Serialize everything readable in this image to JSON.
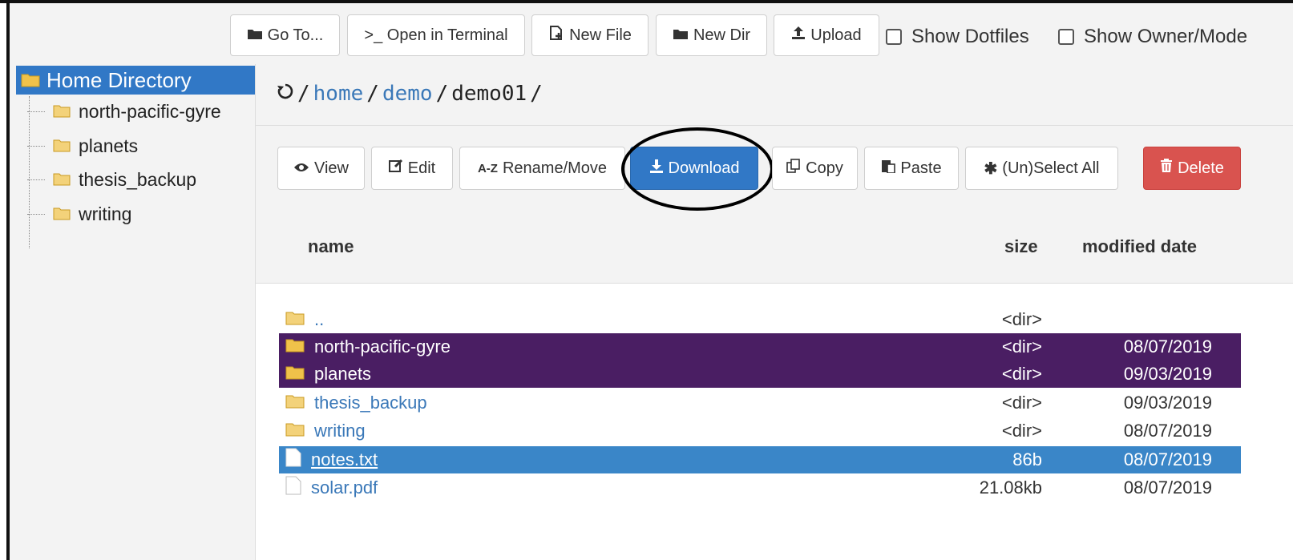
{
  "toolbar": {
    "goto_label": "Go To...",
    "terminal_label": ">_ Open in Terminal",
    "newfile_label": "New File",
    "newdir_label": "New Dir",
    "upload_label": "Upload",
    "show_dotfiles_label": "Show Dotfiles",
    "show_owner_label": "Show Owner/Mode"
  },
  "sidebar": {
    "home_label": "Home Directory",
    "items": [
      {
        "label": "north-pacific-gyre"
      },
      {
        "label": "planets"
      },
      {
        "label": "thesis_backup"
      },
      {
        "label": "writing"
      }
    ]
  },
  "path": {
    "root": "/",
    "seg1": "home",
    "sep1": "/",
    "seg2": "demo",
    "sep2": "/",
    "seg3": "demo01",
    "sep3": "/"
  },
  "actions": {
    "view_label": "View",
    "edit_label": "Edit",
    "rename_label": "Rename/Move",
    "download_label": "Download",
    "copy_label": "Copy",
    "paste_label": "Paste",
    "selectall_label": "(Un)Select All",
    "delete_label": "Delete"
  },
  "table": {
    "headers": {
      "name": "name",
      "size": "size",
      "date": "modified date"
    },
    "rows": [
      {
        "name": "..",
        "size": "<dir>",
        "date": "",
        "kind": "folder",
        "state": "none"
      },
      {
        "name": "north-pacific-gyre",
        "size": "<dir>",
        "date": "08/07/2019",
        "kind": "folder",
        "state": "purple"
      },
      {
        "name": "planets",
        "size": "<dir>",
        "date": "09/03/2019",
        "kind": "folder",
        "state": "purple"
      },
      {
        "name": "thesis_backup",
        "size": "<dir>",
        "date": "09/03/2019",
        "kind": "folder",
        "state": "none"
      },
      {
        "name": "writing",
        "size": "<dir>",
        "date": "08/07/2019",
        "kind": "folder",
        "state": "none"
      },
      {
        "name": "notes.txt",
        "size": "86b",
        "date": "08/07/2019",
        "kind": "file",
        "state": "blue"
      },
      {
        "name": "solar.pdf",
        "size": "21.08kb",
        "date": "08/07/2019",
        "kind": "file",
        "state": "none"
      }
    ]
  },
  "colors": {
    "primary": "#3178c6",
    "danger": "#d9534f",
    "selected_purple": "#4a1e63",
    "selected_blue": "#3a86c8",
    "folder": "#f0c24a"
  }
}
